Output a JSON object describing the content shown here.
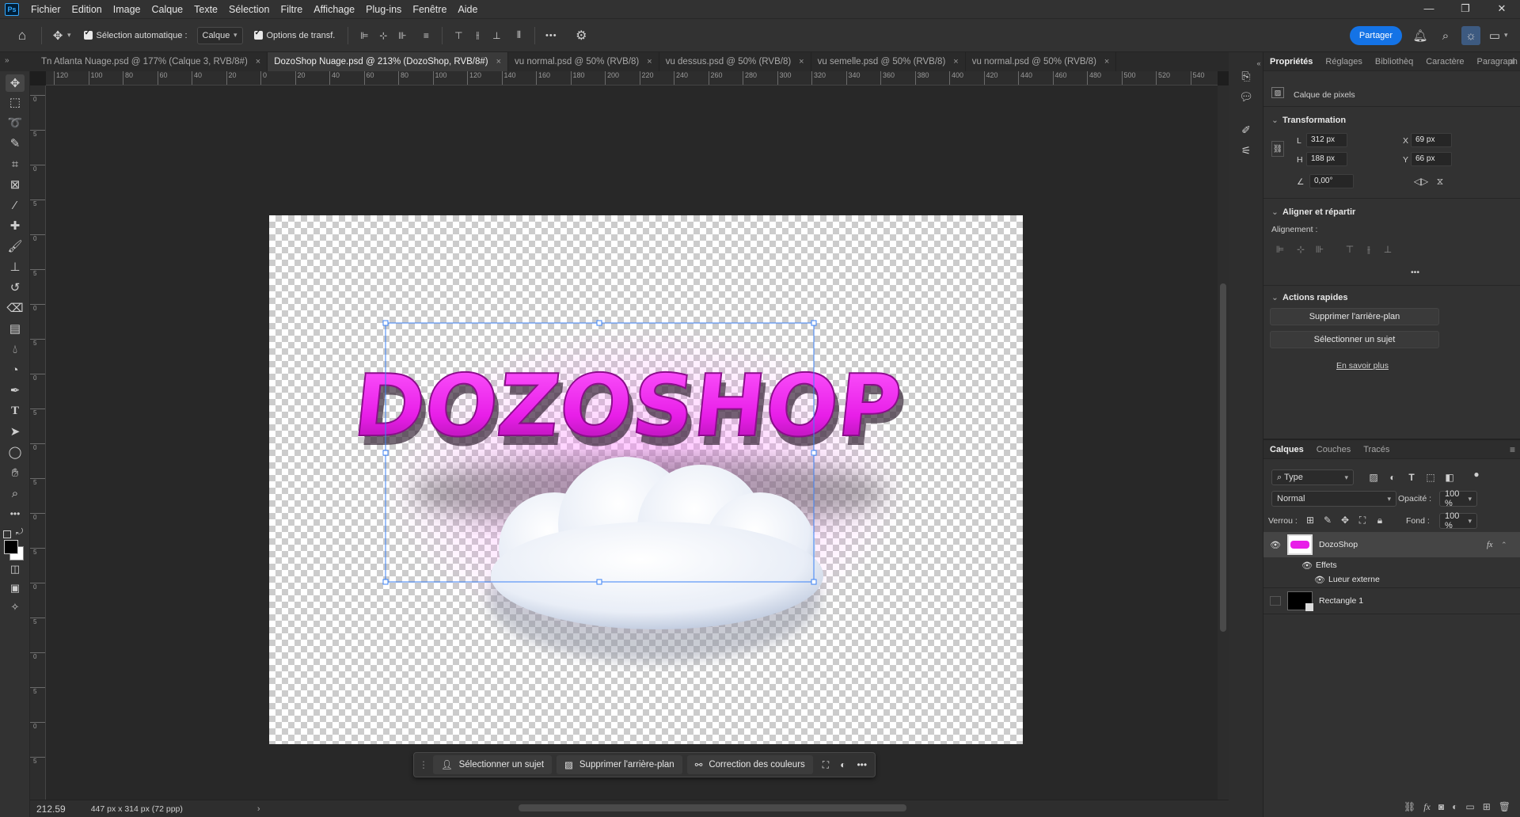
{
  "app": {
    "logo": "Ps",
    "menu": [
      "Fichier",
      "Edition",
      "Image",
      "Calque",
      "Texte",
      "Sélection",
      "Filtre",
      "Affichage",
      "Plug-ins",
      "Fenêtre",
      "Aide"
    ],
    "window_controls": {
      "minimize": "—",
      "restore": "❐",
      "close": "✕"
    }
  },
  "options_bar": {
    "auto_select_label": "Sélection automatique :",
    "auto_select_value": "Calque",
    "transform_options_label": "Options de transf.",
    "more_label": "•••",
    "share_label": "Partager"
  },
  "tabs": [
    {
      "label": "Tn Atlanta Nuage.psd @ 177% (Calque 3, RVB/8#)",
      "active": false
    },
    {
      "label": "DozoShop Nuage.psd @ 213% (DozoShop, RVB/8#)",
      "active": true
    },
    {
      "label": "vu normal.psd @ 50% (RVB/8)",
      "active": false
    },
    {
      "label": "vu dessus.psd @ 50% (RVB/8)",
      "active": false
    },
    {
      "label": "vu semelle.psd @ 50% (RVB/8)",
      "active": false
    },
    {
      "label": "vu normal.psd @ 50% (RVB/8)",
      "active": false
    }
  ],
  "ruler": {
    "h_labels": [
      "120",
      "100",
      "80",
      "60",
      "40",
      "20",
      "0",
      "20",
      "40",
      "60",
      "80",
      "100",
      "120",
      "140",
      "160",
      "180",
      "200",
      "220",
      "240",
      "260",
      "280",
      "300",
      "320",
      "340",
      "360",
      "380",
      "400",
      "420",
      "440",
      "460",
      "480",
      "500",
      "520",
      "540"
    ],
    "v_labels": [
      "0",
      "5",
      "0",
      "5",
      "0",
      "5",
      "0",
      "5",
      "0",
      "5",
      "0",
      "5",
      "0",
      "5",
      "0",
      "5",
      "0",
      "5",
      "0",
      "5"
    ]
  },
  "canvas": {
    "artwork_text": "DOZOSHOP",
    "text_color": "#e81ee8",
    "glow_color": "#ff66ff"
  },
  "task_bar": {
    "select_subject": "Sélectionner un sujet",
    "remove_bg": "Supprimer l'arrière-plan",
    "color_correction": "Correction des couleurs",
    "more": "•••"
  },
  "status": {
    "zoom": "212.59",
    "doc_info": "447 px x 314 px (72 ppp)",
    "arrow": "›"
  },
  "properties": {
    "tabs": [
      "Propriétés",
      "Réglages",
      "Bibliothèq",
      "Caractère",
      "Paragraph"
    ],
    "layer_type": "Calque de pixels",
    "transform_title": "Transformation",
    "w_label": "L",
    "w_value": "312 px",
    "h_label": "H",
    "h_value": "188 px",
    "x_label": "X",
    "x_value": "69 px",
    "y_label": "Y",
    "y_value": "66 px",
    "angle_value": "0,00°",
    "align_title": "Aligner et répartir",
    "align_label": "Alignement :",
    "more": "•••",
    "quick_actions_title": "Actions rapides",
    "qa_remove_bg": "Supprimer l'arrière-plan",
    "qa_select_subject": "Sélectionner un sujet",
    "learn_more": "En savoir plus"
  },
  "layers": {
    "tabs": [
      "Calques",
      "Couches",
      "Tracés"
    ],
    "filter_type": "Type",
    "blend_mode": "Normal",
    "opacity_label": "Opacité :",
    "opacity_value": "100 %",
    "lock_label": "Verrou :",
    "fill_label": "Fond :",
    "fill_value": "100 %",
    "items": [
      {
        "name": "DozoShop",
        "fx": "fx"
      },
      {
        "name": "Effets"
      },
      {
        "name": "Lueur externe"
      },
      {
        "name": "Rectangle 1"
      }
    ]
  }
}
